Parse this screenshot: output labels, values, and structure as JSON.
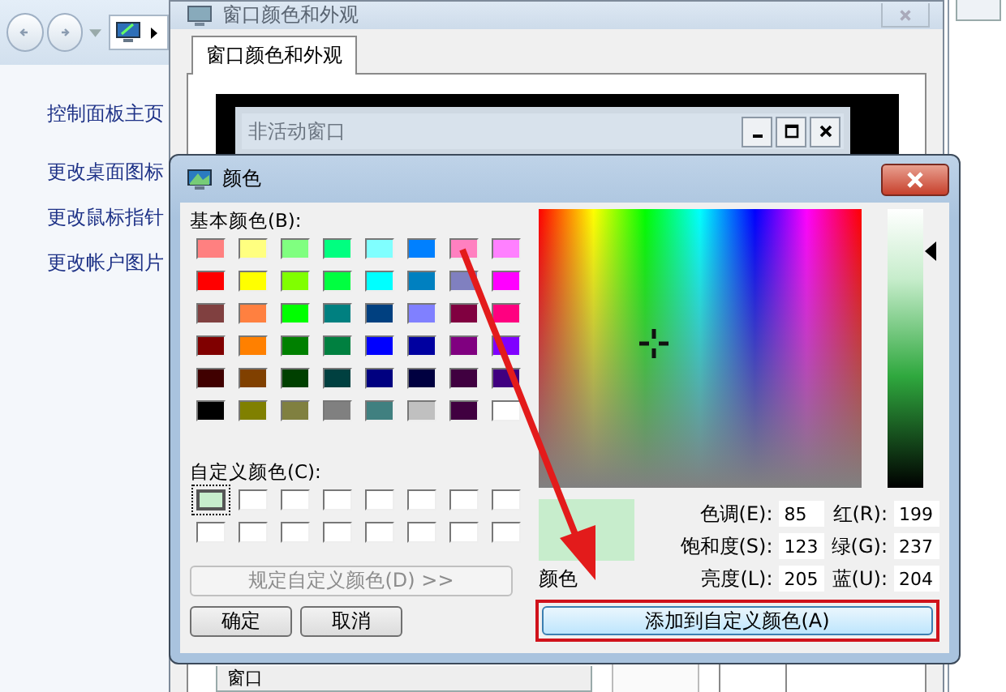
{
  "explorer": {
    "nav_items": [
      "控制面板主页",
      "更改桌面图标",
      "更改鼠标指针",
      "更改帐户图片"
    ]
  },
  "appearance_window": {
    "title": "窗口颜色和外观",
    "tabs": [
      {
        "label": "窗口颜色和外观",
        "selected": true
      }
    ],
    "preview": {
      "inactive_title": "非活动窗口"
    },
    "item_dropdown": {
      "value": "窗口"
    }
  },
  "color_dialog": {
    "title": "颜色",
    "basic_label": "基本颜色(B):",
    "basic_colors": [
      [
        {
          "color": "#ff8080"
        },
        {
          "color": "#ffff80"
        },
        {
          "color": "#80ff80"
        },
        {
          "color": "#00ff80"
        },
        {
          "color": "#80ffff"
        },
        {
          "color": "#0080ff"
        },
        {
          "color": "#ff80c0"
        },
        {
          "color": "#ff80ff"
        }
      ],
      [
        {
          "color": "#ff0000"
        },
        {
          "color": "#ffff00"
        },
        {
          "color": "#80ff00"
        },
        {
          "color": "#00ff40"
        },
        {
          "color": "#00ffff"
        },
        {
          "color": "#0080c0"
        },
        {
          "color": "#8080c0"
        },
        {
          "color": "#ff00ff"
        }
      ],
      [
        {
          "color": "#804040"
        },
        {
          "color": "#ff8040"
        },
        {
          "color": "#00ff00"
        },
        {
          "color": "#008080"
        },
        {
          "color": "#004080"
        },
        {
          "color": "#8080ff"
        },
        {
          "color": "#800040"
        },
        {
          "color": "#ff0080"
        }
      ],
      [
        {
          "color": "#800000"
        },
        {
          "color": "#ff8000"
        },
        {
          "color": "#008000"
        },
        {
          "color": "#008040"
        },
        {
          "color": "#0000ff"
        },
        {
          "color": "#0000a0"
        },
        {
          "color": "#800080"
        },
        {
          "color": "#8000ff"
        }
      ],
      [
        {
          "color": "#400000"
        },
        {
          "color": "#804000"
        },
        {
          "color": "#004000"
        },
        {
          "color": "#004040"
        },
        {
          "color": "#000080"
        },
        {
          "color": "#000040"
        },
        {
          "color": "#400040"
        },
        {
          "color": "#400080"
        }
      ],
      [
        {
          "color": "#000000"
        },
        {
          "color": "#808000"
        },
        {
          "color": "#808040"
        },
        {
          "color": "#808080"
        },
        {
          "color": "#408080"
        },
        {
          "color": "#c0c0c0"
        },
        {
          "color": "#400040"
        },
        {
          "color": "#ffffff"
        }
      ]
    ],
    "custom_label": "自定义颜色(C):",
    "custom_colors": [
      [
        {
          "color": "#c7edcc",
          "selected": true
        },
        {
          "color": "#ffffff",
          "selected": false
        },
        {
          "color": "#ffffff",
          "selected": false
        },
        {
          "color": "#ffffff",
          "selected": false
        },
        {
          "color": "#ffffff",
          "selected": false
        },
        {
          "color": "#ffffff",
          "selected": false
        },
        {
          "color": "#ffffff",
          "selected": false
        },
        {
          "color": "#ffffff",
          "selected": false
        }
      ],
      [
        {
          "color": "#ffffff",
          "selected": false
        },
        {
          "color": "#ffffff",
          "selected": false
        },
        {
          "color": "#ffffff",
          "selected": false
        },
        {
          "color": "#ffffff",
          "selected": false
        },
        {
          "color": "#ffffff",
          "selected": false
        },
        {
          "color": "#ffffff",
          "selected": false
        },
        {
          "color": "#ffffff",
          "selected": false
        },
        {
          "color": "#ffffff",
          "selected": false
        }
      ]
    ],
    "define_button": {
      "label": "规定自定义颜色(D) >>",
      "disabled": true
    },
    "ok_button": "确定",
    "cancel_button": "取消",
    "luminance": {
      "level": 0.85
    },
    "preview": {
      "color": "#c7edcc",
      "label": "颜色"
    },
    "fields": [
      {
        "label": "色调(E):",
        "value": "85"
      },
      {
        "label": "红(R):",
        "value": "199"
      },
      {
        "label": "饱和度(S):",
        "value": "123"
      },
      {
        "label": "绿(G):",
        "value": "237"
      },
      {
        "label": "亮度(L):",
        "value": "205"
      },
      {
        "label": "蓝(U):",
        "value": "204"
      }
    ],
    "add_button": "添加到自定义颜色(A)"
  }
}
